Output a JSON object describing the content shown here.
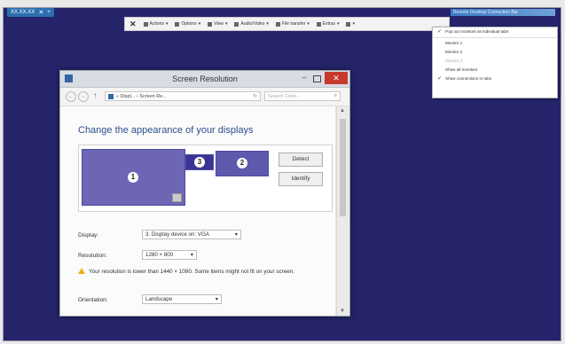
{
  "remote_bar": {
    "host": "XX.XX.XX",
    "status_text": "Remote Desktop Connection Bar"
  },
  "toolbar": {
    "close": "✕",
    "items": [
      "Actions",
      "Options",
      "View",
      "Audio/Video",
      "File transfer",
      "Extras",
      "Monitor"
    ]
  },
  "monitor_menu": {
    "items": [
      {
        "label": "Pop out monitors as individual tabs",
        "checked": true,
        "dim": false
      },
      {
        "label": "Monitor 1",
        "checked": false,
        "dim": false
      },
      {
        "label": "Monitor 2",
        "checked": false,
        "dim": false
      },
      {
        "label": "Monitor 3",
        "checked": false,
        "dim": true
      },
      {
        "label": "Show all monitors",
        "checked": false,
        "dim": false
      },
      {
        "label": "Show connections in tabs",
        "checked": true,
        "dim": false
      }
    ]
  },
  "window": {
    "title": "Screen Resolution",
    "minimize": "–",
    "close": "✕",
    "nav_back": "←",
    "nav_forward": "→",
    "up": "↑",
    "breadcrumb": "« Displ... › Screen Re...",
    "search_placeholder": "Search Contr...",
    "heading": "Change the appearance of your displays",
    "monitors": [
      "1",
      "3",
      "2"
    ],
    "detect_label": "Detect",
    "identify_label": "Identify",
    "display_label": "Display:",
    "display_value": "3. Display device on: VGA",
    "resolution_label": "Resolution:",
    "resolution_value": "1280 × 800",
    "warning_text": "Your resolution is lower than 1440 × 1080. Some items might not fit on your screen.",
    "orientation_label": "Orientation:",
    "orientation_value": "Landscape"
  },
  "colors": {
    "desktop": "#25246a",
    "monitor_selected": "#3a3595",
    "close_red": "#c7392b",
    "heading_blue": "#2c4f8c"
  }
}
